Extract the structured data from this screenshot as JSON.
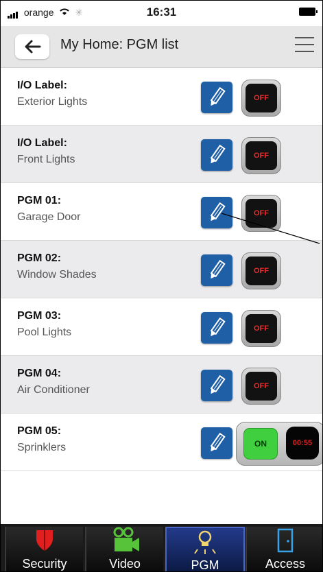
{
  "status_bar": {
    "carrier": "orange",
    "time": "16:31"
  },
  "header": {
    "title": "My Home: PGM list"
  },
  "rows": [
    {
      "label": "I/O Label:",
      "name": "Exterior Lights",
      "state": "OFF"
    },
    {
      "label": "I/O Label:",
      "name": "Front Lights",
      "state": "OFF"
    },
    {
      "label": "PGM 01:",
      "name": "Garage Door",
      "state": "OFF"
    },
    {
      "label": "PGM 02:",
      "name": "Window Shades",
      "state": "OFF"
    },
    {
      "label": "PGM 03:",
      "name": "Pool Lights",
      "state": "OFF"
    },
    {
      "label": "PGM 04:",
      "name": "Air Conditioner",
      "state": "OFF"
    },
    {
      "label": "PGM 05:",
      "name": "Sprinklers",
      "state": "ON",
      "timer": "00:55"
    }
  ],
  "tabs": [
    {
      "label": "Security",
      "icon": "shield-icon"
    },
    {
      "label": "Video",
      "icon": "video-camera-icon"
    },
    {
      "label": "PGM",
      "icon": "lightbulb-icon",
      "active": true
    },
    {
      "label": "Access",
      "icon": "door-icon"
    }
  ],
  "colors": {
    "accent_blue": "#1f5fa6",
    "off_red": "#e63030",
    "on_green": "#3fcf3f",
    "active_tab": "#233a8a"
  }
}
